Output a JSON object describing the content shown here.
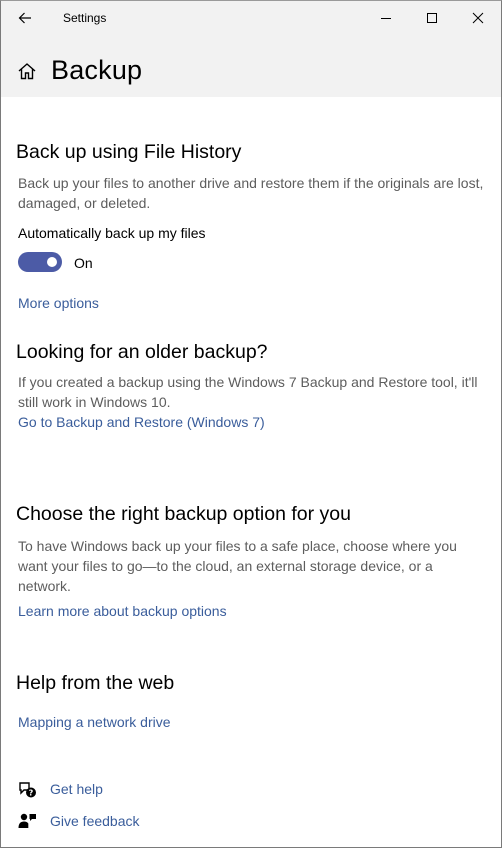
{
  "window": {
    "title": "Settings"
  },
  "header": {
    "page_title": "Backup",
    "icon": "home-icon"
  },
  "sections": {
    "file_history": {
      "heading": "Back up using File History",
      "description": "Back up your files to another drive and restore them if the originals are lost, damaged, or deleted.",
      "toggle_label": "Automatically back up my files",
      "toggle_state": "On",
      "toggle_on": true,
      "link": "More options"
    },
    "older_backup": {
      "heading": "Looking for an older backup?",
      "description": "If you created a backup using the Windows 7 Backup and Restore tool, it'll still work in Windows 10.",
      "link": "Go to Backup and Restore (Windows 7)"
    },
    "choose_option": {
      "heading": "Choose the right backup option for you",
      "description": "To have Windows back up your files to a safe place, choose where you want your files to go—to the cloud, an external storage device, or a network.",
      "link": "Learn more about backup options"
    },
    "help_web": {
      "heading": "Help from the web",
      "link": "Mapping a network drive"
    }
  },
  "footer": {
    "get_help": "Get help",
    "give_feedback": "Give feedback"
  },
  "colors": {
    "accent": "#4c5ba6",
    "link": "#3a5d9b",
    "header_bg": "#f2f2f2",
    "secondary_text": "#5d5d5d"
  }
}
